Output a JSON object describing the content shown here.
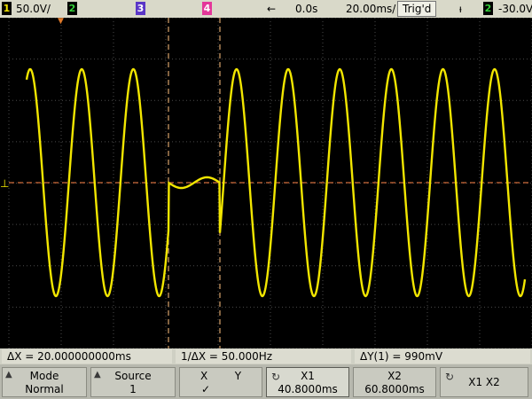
{
  "topbar": {
    "ch1_num": "1",
    "ch1_scale": "50.0V/",
    "ch2_num": "2",
    "ch3_num": "3",
    "ch4_num": "4",
    "delay_arrow": "←",
    "delay": "0.0s",
    "timebase": "20.00ms/",
    "trigger_status": "Trig'd",
    "trigger_edge": "ᵼ",
    "trig_src": "2",
    "trig_level": "-30.0V"
  },
  "screen": {
    "ground_marker": "⊥",
    "trigger_marker": "▼"
  },
  "measurements": {
    "delta_x": "ΔX = 20.000000000ms",
    "inv_delta_x": "1/ΔX = 50.000Hz",
    "delta_y": "ΔY(1) = 990mV"
  },
  "softkeys": [
    {
      "line1": "Mode",
      "line2": "Normal"
    },
    {
      "line1": "Source",
      "line2": "1"
    },
    {
      "line1": "X        Y",
      "line2": "✓"
    },
    {
      "line1": "X1",
      "line2": "40.8000ms"
    },
    {
      "line1": "X2",
      "line2": "60.8000ms"
    },
    {
      "line1": "X1 X2",
      "line2": ""
    }
  ],
  "colors": {
    "trace": "#f2e600",
    "grid": "#555555",
    "cursor": "#d8a36a",
    "ground_ref": "#d06b3a"
  }
}
